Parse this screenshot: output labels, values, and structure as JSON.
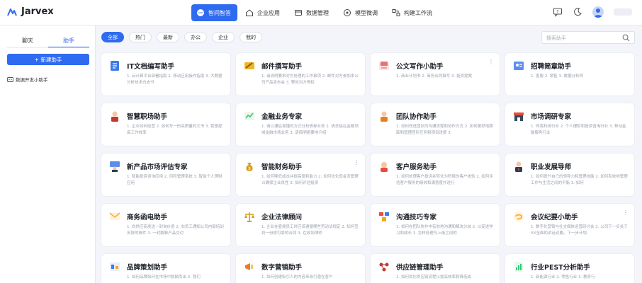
{
  "app": {
    "name": "Jarvex"
  },
  "nav": [
    {
      "label": "智问智答",
      "icon": "chat-bubble-icon",
      "active": true
    },
    {
      "label": "企业应用",
      "icon": "house-icon",
      "active": false
    },
    {
      "label": "数据管理",
      "icon": "folder-icon",
      "active": false
    },
    {
      "label": "模型微调",
      "icon": "cube-icon",
      "active": false
    },
    {
      "label": "构建工作流",
      "icon": "workflow-icon",
      "active": false
    }
  ],
  "header_icons": [
    "feedback-icon",
    "moon-icon",
    "user-avatar-icon"
  ],
  "sidebar": {
    "tabs": [
      {
        "label": "聊天",
        "active": false
      },
      {
        "label": "助手",
        "active": true
      }
    ],
    "new_button": "+ 新建助手",
    "items": [
      {
        "label": "数据开发小助手",
        "icon": "assistant-icon"
      }
    ]
  },
  "filters": [
    {
      "label": "全部",
      "active": true
    },
    {
      "label": "热门",
      "active": false
    },
    {
      "label": "最新",
      "active": false
    },
    {
      "label": "办公",
      "active": false
    },
    {
      "label": "企业",
      "active": false
    },
    {
      "label": "我的",
      "active": false
    }
  ],
  "search": {
    "placeholder": "搜索助手"
  },
  "cards": [
    {
      "title": "IT文档编写助手",
      "desc": "1. 云计算平台部署指南 2. 移动应用操作指南 3. 大数据分析技术白皮书",
      "icon": "document-icon",
      "color": "#3b7be8",
      "more": false
    },
    {
      "title": "邮件撰写助手",
      "desc": "1. 请说明要求对方处理的工作事项 2. 邮件对方参加本公司产品发布会 3. 警告对方停权",
      "icon": "pen-icon",
      "color": "#f0b429",
      "more": false
    },
    {
      "title": "公文写作小助手",
      "desc": "1. 商业计划书 2. 商务合同撰写 3. 投资提案",
      "icon": "writing-icon",
      "color": "#e57373",
      "more": true
    },
    {
      "title": "招聘简章助手",
      "desc": "1. 客服 2. 销售 3. 数据分析师",
      "icon": "recruit-icon",
      "color": "#5b8def",
      "more": false
    },
    {
      "title": "智慧职场助手",
      "desc": "1. 企业如何经营 2. 如何写一份高质量的文书 3. 我想提高工作效率",
      "icon": "briefcase-icon",
      "color": "#c0392b",
      "more": false
    },
    {
      "title": "金融业务专家",
      "desc": "1. 请以通俗易懂的方式分析债券业务 2. 请总结在金融领域金融市场业务 3. 请简明扼要地介绍",
      "icon": "chart-icon",
      "color": "#2ecc71",
      "more": false
    },
    {
      "title": "团队协作助手",
      "desc": "1. 如何改进团队的沟通流程和协作方式 2. 如何更好地跟踪和管理团队任务和项目进度 3.",
      "icon": "team-icon",
      "color": "#e67e22",
      "more": false
    },
    {
      "title": "市场调研专家",
      "desc": "1. 伴我科技行业 2. 个人理财和投资咨询行业 3. 移动金融服务行业",
      "icon": "store-icon",
      "color": "#34495e",
      "more": false
    },
    {
      "title": "新产品市场评估专家",
      "desc": "1. 智能投资咨询应用 2. 风险管理系统 3. 智能个人理财应用",
      "icon": "presenter-icon",
      "color": "#2c3e50",
      "more": false
    },
    {
      "title": "智能财务助手",
      "desc": "1. 如何降低成本并提高盈利能力 2. 如何优化现金流管理以确保企业良性 3. 如何评估投资",
      "icon": "money-bag-icon",
      "color": "#d4a017",
      "more": true
    },
    {
      "title": "客户服务助手",
      "desc": "1. 如何处理客户投诉并转化为积极的客户体验 2. 如何评估客户服务的绩效和满意度并进行",
      "icon": "service-icon",
      "color": "#e74c3c",
      "more": false
    },
    {
      "title": "职业发展导师",
      "desc": "1. 如何提升自己的领导力和管理技能 2. 如何有效地管理工作与生活之间的平衡 3. 如何",
      "icon": "mentor-icon",
      "color": "#2c3e50",
      "more": false
    },
    {
      "title": "商务函电助手",
      "desc": "1. 向供应商发送一封询价函 2. 向员工通知公司内部培训安排的邮件 3. 一封解释产品交付",
      "icon": "letter-icon",
      "color": "#f5a623",
      "more": false
    },
    {
      "title": "企业法律顾问",
      "desc": "1. 企业在雇佣员工时应该遵循哪些劳动法规定 2. 如何签到一份很可靠的合同 3. 在收到律师",
      "icon": "scale-icon",
      "color": "#d4a017",
      "more": false
    },
    {
      "title": "沟通技巧专家",
      "desc": "1. 如何在团队协作中有效地沟通和解决分歧 2. 以促进学习和成长 3. 怎样处理与上级之间的",
      "icon": "communication-icon",
      "color": "#e74c3c",
      "more": false
    },
    {
      "title": "会议纪要小助手",
      "desc": "1. 数字化营销与社交媒体运营研讨会 2. 公司下一步关于XX全面的讲话议要。下一步计划",
      "icon": "meeting-icon",
      "color": "#f5a623",
      "more": true
    },
    {
      "title": "品牌策划助手",
      "desc": "1. 如何品牌如何在市场中脱颖而出 2. 我们",
      "icon": "brand-icon",
      "color": "#3b7be8",
      "more": false
    },
    {
      "title": "数字营销助手",
      "desc": "1. 如何创建吸引人的内容来吸引潜在客户",
      "icon": "megaphone-icon",
      "color": "#e67e22",
      "more": false
    },
    {
      "title": "供应链管理助手",
      "desc": "1. 如何优化供应链流程以提高效率和降低成",
      "icon": "supply-chain-icon",
      "color": "#c0392b",
      "more": false
    },
    {
      "title": "行业PEST分析助手",
      "desc": "1. 新能源行业 2. 零售行业 3. 教育行",
      "icon": "analysis-icon",
      "color": "#2ecc71",
      "more": false
    }
  ]
}
